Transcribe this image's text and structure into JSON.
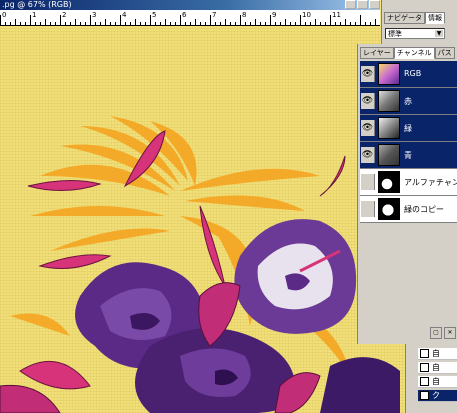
{
  "window": {
    "title": ".pg @ 67% (RGB)"
  },
  "ruler": {
    "labels": [
      "0",
      "1",
      "2",
      "3",
      "4",
      "5",
      "6",
      "7",
      "8",
      "9",
      "10",
      "11"
    ]
  },
  "info_palette": {
    "tabs": [
      "ナビゲータ",
      "情報"
    ],
    "select_value": "標準"
  },
  "layers_palette": {
    "tabs": [
      "レイヤー",
      "チャンネル",
      "パス"
    ],
    "channels": [
      {
        "name": "RGB",
        "visible": true,
        "selected": true
      },
      {
        "name": "赤",
        "visible": true,
        "selected": true
      },
      {
        "name": "緑",
        "visible": true,
        "selected": true
      },
      {
        "name": "青",
        "visible": true,
        "selected": true
      },
      {
        "name": "アルファチャンネル",
        "visible": false,
        "selected": false
      },
      {
        "name": "緑のコピー",
        "visible": false,
        "selected": false
      }
    ]
  },
  "history_palette": {
    "items": [
      "自",
      "自",
      "自",
      "ク"
    ]
  },
  "colors": {
    "canvas_yellow": "#f1e07a",
    "palm_orange": "#f5a623",
    "hibiscus_purple": "#5b2a86",
    "hibiscus_magenta": "#d6337a",
    "selection_blue": "#0a246a"
  },
  "icons": {
    "visibility": "eye-icon",
    "palette_buttons": [
      "new-channel-icon",
      "delete-icon"
    ]
  }
}
